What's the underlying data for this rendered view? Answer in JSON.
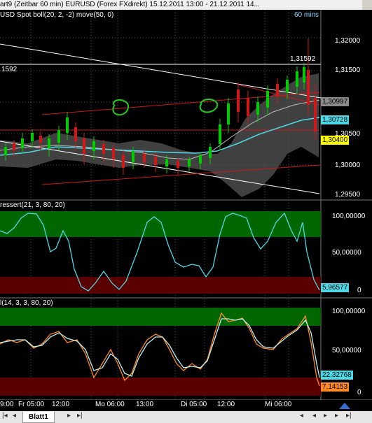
{
  "header": {
    "title": "art9 (Zeitbar 60 min)  EURUSD (Forex FXdirekt) 15.12.2011 13:00 - 21.12.2011 14...",
    "subtitle": "USD Spot  boll(20, 2, -2)  move(50, 0)",
    "timeframe": "60 mins"
  },
  "price_pane": {
    "ticks": [
      "1,32000",
      "1,31500",
      "1,30500",
      "1,30000",
      "1,29500"
    ],
    "tags": {
      "top_line": "1,31592",
      "left_line": "1592",
      "gray": "1,30997",
      "cyan": "1,30728",
      "yellow": "1,30400"
    }
  },
  "stoch1_pane": {
    "title": "ressert(21, 3, 80, 20)",
    "ticks": [
      "100,00000",
      "50,00000",
      "0"
    ],
    "current": "5,96577"
  },
  "stoch2_pane": {
    "title": "l(14, 3, 3, 80, 20)",
    "ticks": [
      "100,00000",
      "50,00000",
      "0"
    ],
    "current_a": "22,32768",
    "current_b": "7,14153"
  },
  "x_axis": {
    "labels": [
      "9:00",
      "Fr 05:00",
      "12:00",
      "Mo 06:00",
      "13:00",
      "Di 05:00",
      "12:00",
      "Mi 06:00"
    ]
  },
  "tabs": {
    "sheet": "Blatt1"
  },
  "colors": {
    "green_zone": "#006600",
    "red_zone": "#5a0000",
    "cyan": "#4ed8e6",
    "orange": "#ff8a1f",
    "red": "#d01818",
    "yellow_tag": "#ffff00"
  }
}
